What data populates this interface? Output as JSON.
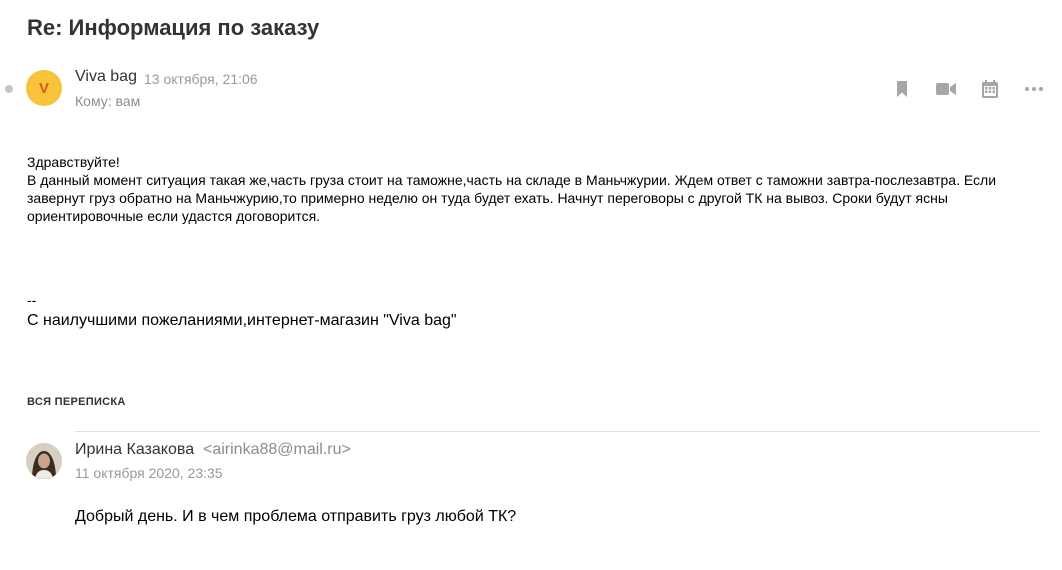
{
  "message": {
    "subject": "Re: Информация по заказу",
    "sender": {
      "avatar_letter": "V",
      "name": "Viva bag",
      "date": "13 октября, 21:06",
      "to": "Кому: вам"
    },
    "toolbar": [
      {
        "icon": "bookmark-icon"
      },
      {
        "icon": "video-camera-icon"
      },
      {
        "icon": "calendar-icon"
      },
      {
        "icon": "more-options-icon"
      }
    ],
    "body": {
      "greeting": "Здравствуйте!",
      "paragraph": "В данный момент ситуация такая же,часть груза стоит на таможне,часть на складе в Маньчжурии. Ждем ответ с таможни завтра-послезавтра. Если завернут груз обратно на Маньчжурию,то примерно неделю он туда будет ехать. Начнут переговоры с другой ТК на вывоз. Сроки будут ясны ориентировочные если удастся договорится."
    },
    "signature": {
      "dash": "--",
      "text": "С наилучшими пожеланиями,интернет-магазин \"Viva bag\""
    }
  },
  "thread": {
    "label": "ВСЯ ПЕРЕПИСКА",
    "reply": {
      "name": "Ирина Казакова",
      "email": "<airinka88@mail.ru>",
      "date": "11 октября 2020, 23:35",
      "text": "Добрый день. И в чем проблема отправить груз любой ТК?"
    }
  },
  "colors": {
    "avatar_bg": "#f8c33a",
    "avatar_letter": "#d35d17",
    "icon_gray": "#a6a6a6"
  }
}
